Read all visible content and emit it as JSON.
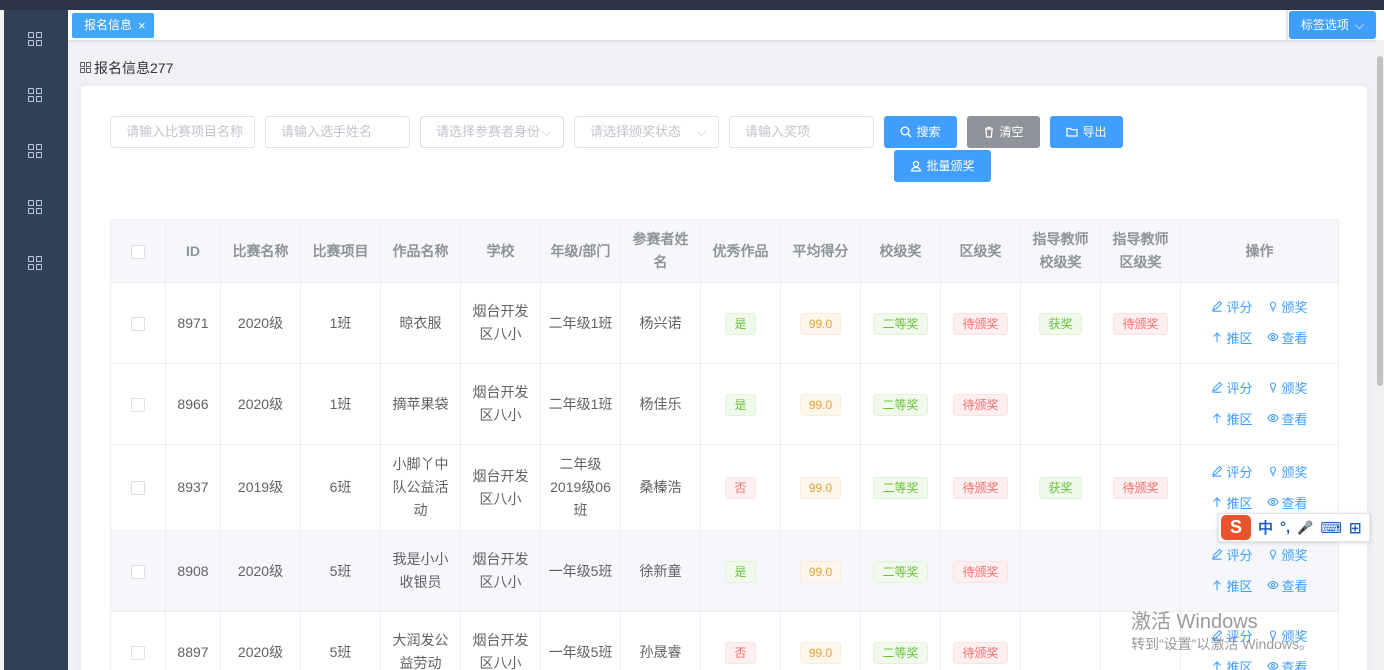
{
  "tags": {
    "active_label": "报名信息",
    "close_glyph": "×",
    "options_label": "标签选项",
    "options_arrow": "⌵"
  },
  "page": {
    "title": "报名信息277"
  },
  "filters": {
    "project_placeholder": "请输入比赛项目名称",
    "name_placeholder": "请输入选手姓名",
    "identity_placeholder": "请选择参赛者身份",
    "award_status_placeholder": "请选择颁奖状态",
    "prize_placeholder": "请输入奖项",
    "arrow": "⌵"
  },
  "buttons": {
    "search": "搜索",
    "clear": "清空",
    "export": "导出",
    "batch_award": "批量颁奖"
  },
  "table": {
    "headers": {
      "id": "ID",
      "contest": "比赛名称",
      "project": "比赛项目",
      "work": "作品名称",
      "school": "学校",
      "grade": "年级/部门",
      "name": "参赛者姓名",
      "excellent": "优秀作品",
      "avg": "平均得分",
      "school_award": "校级奖",
      "district_award": "区级奖",
      "teacher_school": "指导教师校级奖",
      "teacher_district": "指导教师区级奖",
      "ops": "操作"
    },
    "ops": {
      "score": "评分",
      "award": "颁奖",
      "recommend": "推区",
      "view": "查看"
    },
    "rows": [
      {
        "id": "8971",
        "contest": "2020级",
        "project": "1班",
        "work": "晾衣服",
        "school": "烟台开发区八小",
        "grade": "二年级1班",
        "name": "杨兴诺",
        "excellent": "是",
        "avg": "99.0",
        "school_award": "二等奖",
        "district_award": "待颁奖",
        "teacher_school": "获奖",
        "teacher_district": "待颁奖"
      },
      {
        "id": "8966",
        "contest": "2020级",
        "project": "1班",
        "work": "摘苹果袋",
        "school": "烟台开发区八小",
        "grade": "二年级1班",
        "name": "杨佳乐",
        "excellent": "是",
        "avg": "99.0",
        "school_award": "二等奖",
        "district_award": "待颁奖",
        "teacher_school": "",
        "teacher_district": ""
      },
      {
        "id": "8937",
        "contest": "2019级",
        "project": "6班",
        "work": "小脚丫中队公益活动",
        "school": "烟台开发区八小",
        "grade": "二年级2019级06班",
        "name": "桑榛浩",
        "excellent": "否",
        "avg": "99.0",
        "school_award": "二等奖",
        "district_award": "待颁奖",
        "teacher_school": "获奖",
        "teacher_district": "待颁奖"
      },
      {
        "id": "8908",
        "contest": "2020级",
        "project": "5班",
        "work": "我是小小收银员",
        "school": "烟台开发区八小",
        "grade": "一年级5班",
        "name": "徐新童",
        "excellent": "是",
        "avg": "99.0",
        "school_award": "二等奖",
        "district_award": "待颁奖",
        "teacher_school": "",
        "teacher_district": ""
      },
      {
        "id": "8897",
        "contest": "2020级",
        "project": "5班",
        "work": "大润发公益劳动",
        "school": "烟台开发区八小",
        "grade": "一年级5班",
        "name": "孙晟睿",
        "excellent": "否",
        "avg": "99.0",
        "school_award": "二等奖",
        "district_award": "待颁奖",
        "teacher_school": "",
        "teacher_district": ""
      }
    ]
  },
  "ime": {
    "logo": "S",
    "lang": "中",
    "punct": "°,",
    "mic": "🎤",
    "keyboard": "⌨",
    "grid": "⊞"
  },
  "watermark": {
    "line1": "激活 Windows",
    "line2": "转到“设置”以激活 Windows。"
  },
  "colors": {
    "primary": "#409eff",
    "sidebar": "#304156",
    "success": "#67c23a",
    "danger": "#f56c6c",
    "warning": "#e6a23c"
  }
}
